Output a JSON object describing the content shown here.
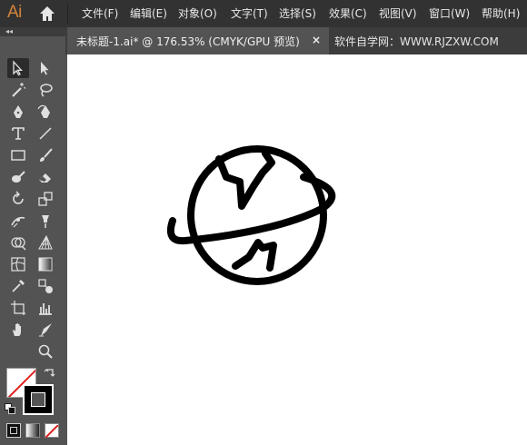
{
  "app": {
    "logo_text": "Ai"
  },
  "menu": {
    "items": [
      "文件(F)",
      "编辑(E)",
      "对象(O)",
      "文字(T)",
      "选择(S)",
      "效果(C)",
      "视图(V)",
      "窗口(W)",
      "帮助(H)"
    ]
  },
  "panel": {
    "collapse_label": "◂◂"
  },
  "tabs": {
    "active_title": "未标题-1.ai* @ 176.53% (CMYK/GPU 预览)",
    "close_glyph": "×",
    "other_title": "软件自学网：WWW.RJZXW.COM"
  },
  "colors": {
    "menubar_bg": "#323232",
    "panel_bg": "#535353",
    "canvas_bg": "#ffffff",
    "logo": "#d4843a",
    "artwork_stroke": "#000000",
    "none_slash": "#e02020"
  },
  "toolbar": {
    "tools_left": [
      "selection-tool",
      "magic-wand-tool",
      "pen-tool",
      "type-tool",
      "rectangle-tool",
      "blob-brush-tool",
      "rotate-tool",
      "width-tool",
      "shape-builder-tool",
      "mesh-tool",
      "eyedropper-tool",
      "artboard-tool",
      "hand-tool"
    ],
    "tools_right": [
      "direct-selection-tool",
      "lasso-tool",
      "curvature-tool",
      "line-segment-tool",
      "paintbrush-tool",
      "eraser-tool",
      "scale-tool",
      "puppet-warp-tool",
      "perspective-grid-tool",
      "gradient-tool",
      "blend-tool",
      "graph-tool",
      "slice-tool",
      "zoom-tool"
    ]
  }
}
